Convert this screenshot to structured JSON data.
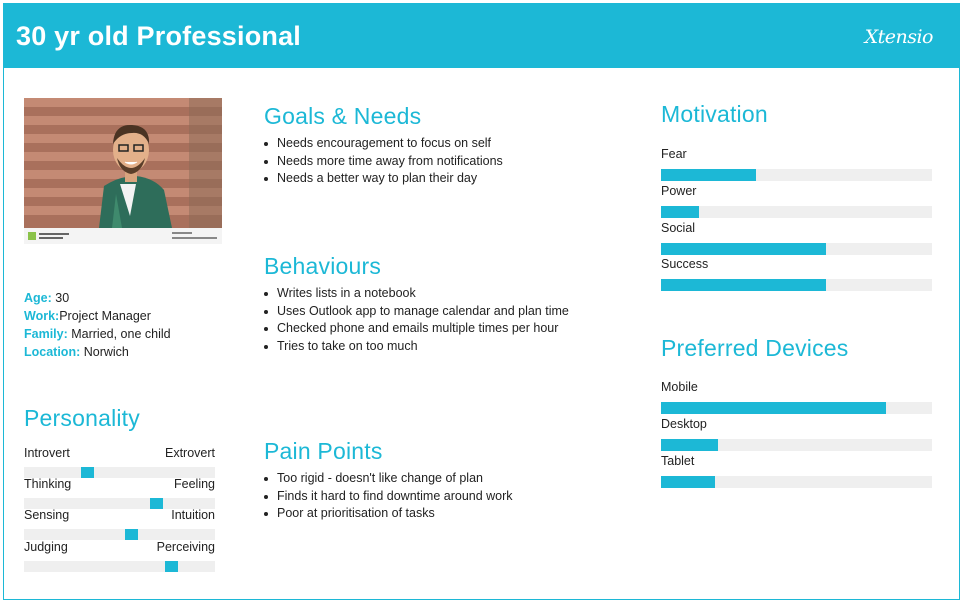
{
  "header": {
    "title": "30 yr old Professional",
    "logo": "Xtensio"
  },
  "colors": {
    "accent": "#1cb8d6",
    "track": "#efefef"
  },
  "demographics": [
    {
      "label": "Age:",
      "value": " 30"
    },
    {
      "label": "Work:",
      "value": "Project Manager"
    },
    {
      "label": "Family:",
      "value": " Married, one child"
    },
    {
      "label": "Location:",
      "value": " Norwich"
    }
  ],
  "personality": {
    "title": "Personality",
    "scales": [
      {
        "left": "Introvert",
        "right": "Extrovert",
        "value": 0.33
      },
      {
        "left": "Thinking",
        "right": "Feeling",
        "value": 0.69
      },
      {
        "left": "Sensing",
        "right": "Intuition",
        "value": 0.56
      },
      {
        "left": "Judging",
        "right": "Perceiving",
        "value": 0.77
      }
    ]
  },
  "goals": {
    "title": "Goals & Needs",
    "items": [
      "Needs encouragement to focus on self",
      "Needs more time away from notifications",
      "Needs a better way to plan their day"
    ]
  },
  "behaviours": {
    "title": "Behaviours",
    "items": [
      "Writes lists in a notebook",
      "Uses Outlook app to manage calendar and plan time",
      "Checked phone and emails multiple times per hour",
      "Tries to take on too much"
    ]
  },
  "pain_points": {
    "title": "Pain Points",
    "items": [
      "Too rigid - doesn't like change of plan",
      "Finds it hard to find downtime around work",
      "Poor at prioritisation of tasks"
    ]
  },
  "motivation": {
    "title": "Motivation",
    "items": [
      {
        "label": "Fear",
        "value": 0.35
      },
      {
        "label": "Power",
        "value": 0.14
      },
      {
        "label": "Social",
        "value": 0.61
      },
      {
        "label": "Success",
        "value": 0.61
      }
    ]
  },
  "devices": {
    "title": "Preferred Devices",
    "items": [
      {
        "label": "Mobile",
        "value": 0.83
      },
      {
        "label": "Desktop",
        "value": 0.21
      },
      {
        "label": "Tablet",
        "value": 0.2
      }
    ]
  },
  "photo": {
    "icon": "person-photo"
  }
}
